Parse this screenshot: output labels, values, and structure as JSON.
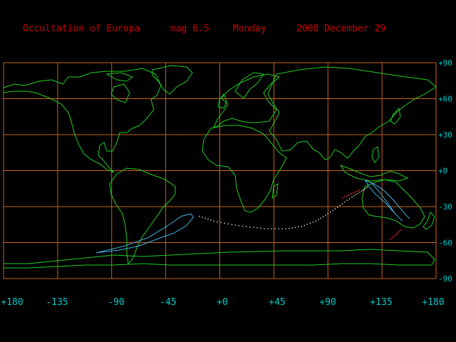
{
  "header": {
    "object": "Occultation of Europa",
    "magnitude": "mag  6.5",
    "weekday": "Monday",
    "date": "2008 December 29"
  },
  "longitude_labels": [
    "+180",
    "-135",
    "-90",
    "-45",
    "+0",
    "+45",
    "+90",
    "+135",
    "+180"
  ],
  "latitude_labels": [
    "+90",
    "+60",
    "+30",
    "+0",
    "-30",
    "-60",
    "-90"
  ],
  "colors": {
    "background": "#000000",
    "title": "#cc0000",
    "grid": "#c86414",
    "coastline": "#22cc22",
    "axis_labels": "#00c8c8",
    "limit_line": "#40b0e0",
    "central_track": "#ffffff",
    "daylight_segment": "#cc2222"
  },
  "map_data": {
    "projection": "equirectangular",
    "longitude_range": [
      -180,
      180
    ],
    "latitude_range": [
      -90,
      90
    ],
    "central_track": [
      [
        -17,
        -38
      ],
      [
        -5,
        -42
      ],
      [
        10,
        -45
      ],
      [
        25,
        -47
      ],
      [
        40,
        -48.5
      ],
      [
        55,
        -48.5
      ],
      [
        68,
        -46.5
      ],
      [
        80,
        -42
      ],
      [
        90,
        -36
      ],
      [
        100,
        -29
      ],
      [
        110,
        -22
      ],
      [
        118,
        -17
      ],
      [
        124,
        -13
      ]
    ],
    "southern_limit": [
      [
        -103,
        -68.5
      ],
      [
        -85,
        -66.5
      ],
      [
        -68,
        -63
      ],
      [
        -52,
        -57
      ],
      [
        -38,
        -52
      ],
      [
        -28,
        -46
      ],
      [
        -22,
        -39
      ],
      [
        -24,
        -36
      ],
      [
        -32,
        -38
      ],
      [
        -45,
        -47
      ],
      [
        -60,
        -56
      ],
      [
        -80,
        -63
      ],
      [
        -103,
        -68.5
      ]
    ],
    "northern_limit": [
      [
        121,
        -8
      ],
      [
        128,
        -11
      ],
      [
        136,
        -16
      ],
      [
        144,
        -24
      ],
      [
        150,
        -31
      ],
      [
        155,
        -37
      ],
      [
        158,
        -40
      ]
    ],
    "inner_limit": [
      [
        121,
        -8
      ],
      [
        124,
        -13
      ],
      [
        130,
        -20
      ],
      [
        138,
        -27
      ],
      [
        146,
        -36
      ],
      [
        152,
        -42
      ],
      [
        146,
        -36
      ],
      [
        134,
        -19
      ],
      [
        126,
        -10
      ],
      [
        121,
        -8
      ]
    ],
    "daylight_segments": [
      [
        [
          102,
          -23
        ],
        [
          110,
          -19
        ],
        [
          117,
          -16
        ]
      ],
      [
        [
          141,
          -58
        ],
        [
          146,
          -54
        ],
        [
          151,
          -49
        ]
      ]
    ]
  }
}
